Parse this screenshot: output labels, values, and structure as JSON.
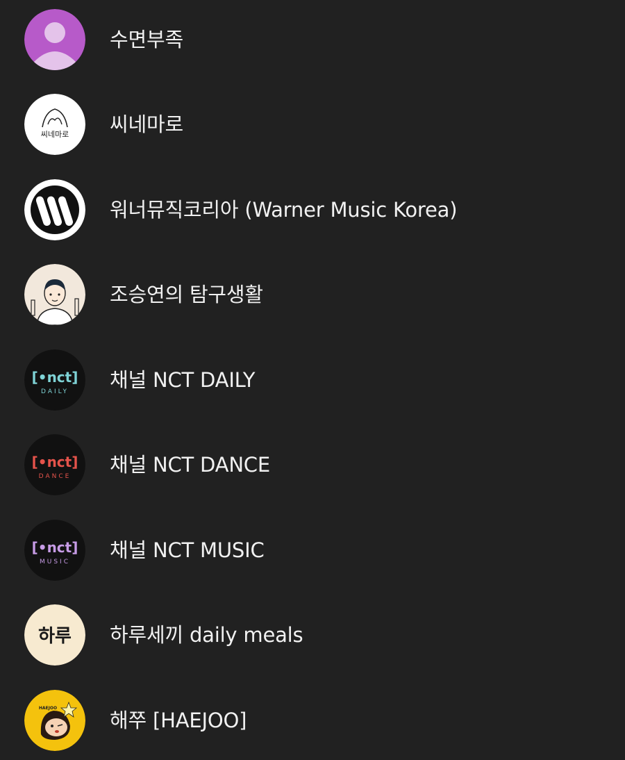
{
  "subscriptions": [
    {
      "name": "수면부족",
      "avatar": "default-profile-icon",
      "color": "#b75ac9"
    },
    {
      "name": "씨네마로",
      "avatar": "cinemaro-logo",
      "logo_text": "씨네마로",
      "color": "#ffffff"
    },
    {
      "name": "워너뮤직코리아 (Warner Music Korea)",
      "avatar": "warner-music-logo",
      "color": "#ffffff"
    },
    {
      "name": "조승연의 탐구생활",
      "avatar": "illustrated-person-avatar",
      "color": "#f2e8dc"
    },
    {
      "name": "채널 NCT DAILY",
      "avatar": "nct-daily-logo",
      "logo_main": "[•nct]",
      "logo_sub": "DAILY",
      "color": "#7fd3d6"
    },
    {
      "name": "채널 NCT DANCE",
      "avatar": "nct-dance-logo",
      "logo_main": "[•nct]",
      "logo_sub": "DANCE",
      "color": "#e5534b"
    },
    {
      "name": "채널 NCT MUSIC",
      "avatar": "nct-music-logo",
      "logo_main": "[•nct]",
      "logo_sub": "MUSIC",
      "color": "#c79ce6"
    },
    {
      "name": "하루세끼 daily meals",
      "avatar": "harusekki-logo",
      "logo_text": "하루",
      "color": "#f7ead0"
    },
    {
      "name": "해쭈 [HAEJOO]",
      "avatar": "haejoo-character-avatar",
      "logo_text": "HAEJOO",
      "color": "#f4c20d"
    }
  ]
}
